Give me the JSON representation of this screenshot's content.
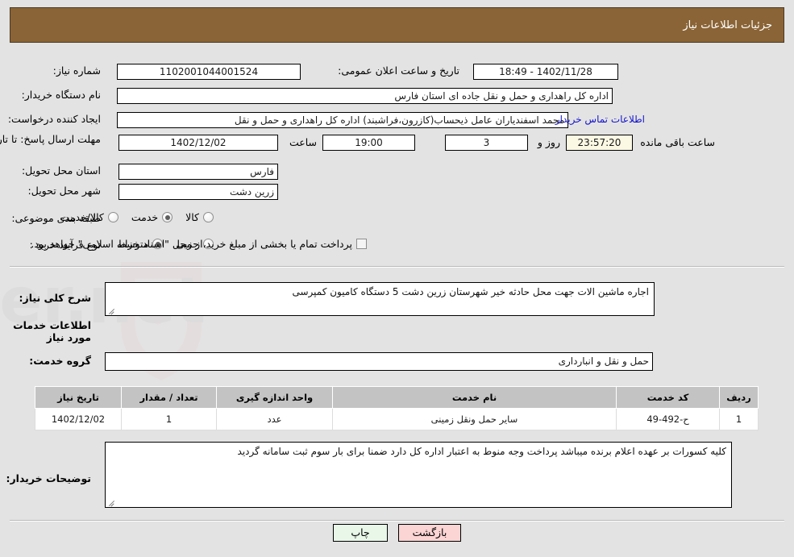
{
  "header": {
    "title": "جزئیات اطلاعات نیاز"
  },
  "summary": {
    "need_number_label": "شماره نیاز:",
    "need_number_value": "1102001044001524",
    "announce_label": "تاریخ و ساعت اعلان عمومی:",
    "announce_value": "1402/11/28 - 18:49",
    "buyer_org_label": "نام دستگاه خریدار:",
    "buyer_org_value": "اداره کل راهداری و حمل و نقل جاده ای استان فارس",
    "requester_label": "ایجاد کننده درخواست:",
    "requester_value": "محمد اسفندیاران عامل ذیحساب(کازرون،فراشبند) اداره کل راهداری و حمل و نقل",
    "contact_link": "اطلاعات تماس خریدار",
    "deadline_label": "مهلت ارسال پاسخ: تا تاریخ:",
    "deadline_date": "1402/12/02",
    "hour_label": "ساعت",
    "deadline_time": "19:00",
    "days_value": "3",
    "days_label": "روز و",
    "countdown_value": "23:57:20",
    "remaining_label": "ساعت باقی مانده",
    "province_label": "استان محل تحویل:",
    "province_value": "فارس",
    "city_label": "شهر محل تحویل:",
    "city_value": "زرین دشت",
    "category_label": "طبقه بندی موضوعی:",
    "category_options": [
      {
        "label": "کالا",
        "selected": false
      },
      {
        "label": "خدمت",
        "selected": true
      },
      {
        "label": "کالا/خدمت",
        "selected": false
      }
    ],
    "process_label": "نوع فرآیند خرید :",
    "process_options": [
      {
        "label": "جزیی",
        "selected": false
      },
      {
        "label": "متوسط",
        "selected": true
      }
    ],
    "treasury_checkbox_label": "پرداخت تمام یا بخشی از مبلغ خرید،از محل \"اسناد خزانه اسلامی\" خواهد بود.",
    "treasury_checked": false
  },
  "description": {
    "label": "شرح کلی نیاز:",
    "value": "اجاره ماشین الات جهت محل حادثه خیر شهرستان زرین دشت 5 دستگاه کامیون کمپرسی"
  },
  "services": {
    "section_title": "اطلاعات خدمات مورد نیاز",
    "group_label": "گروه خدمت:",
    "group_value": "حمل و نقل و انبارداری",
    "columns": [
      "ردیف",
      "کد خدمت",
      "نام خدمت",
      "واحد اندازه گیری",
      "تعداد / مقدار",
      "تاریخ نیاز"
    ],
    "rows": [
      {
        "index": "1",
        "code": "ح-492-49",
        "name": "سایر حمل ونقل زمینی",
        "unit": "عدد",
        "quantity": "1",
        "date": "1402/12/02"
      }
    ]
  },
  "remarks": {
    "label": "توضیحات خریدار:",
    "value": "کلیه کسورات بر عهده اعلام برنده میباشد پرداخت وجه منوط به اعتبار اداره کل دارد ضمنا برای بار سوم ثبت سامانه گردید"
  },
  "actions": {
    "print_label": "چاپ",
    "back_label": "بازگشت"
  },
  "watermark": {
    "text": "AriaTender.net"
  }
}
